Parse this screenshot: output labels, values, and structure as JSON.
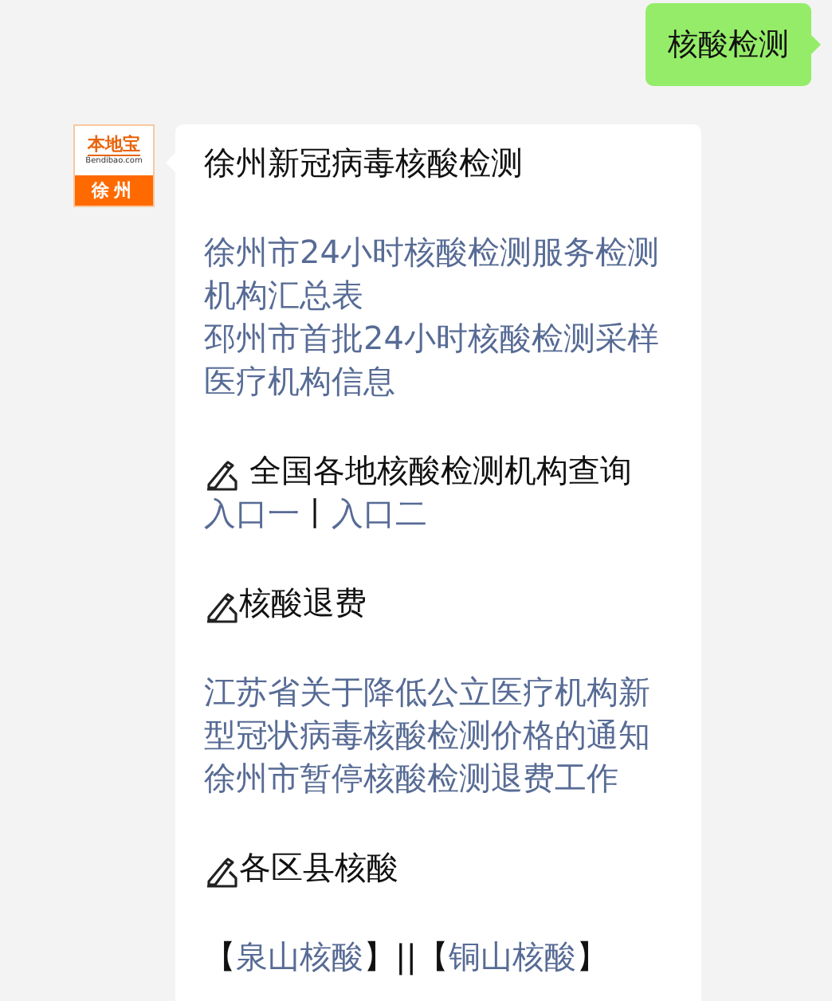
{
  "sent": {
    "text": "核酸检测"
  },
  "avatar": {
    "brand": "本地宝",
    "site": "Bendibao.com",
    "city": "徐州"
  },
  "message": {
    "blocks": [
      {
        "kind": "title",
        "text": "徐州新冠病毒核酸检测"
      },
      {
        "kind": "links",
        "items": [
          "徐州市24小时核酸检测服务检测机构汇总表",
          "邳州市首批24小时核酸检测采样医疗机构信息"
        ]
      },
      {
        "kind": "heading",
        "text": " 全国各地核酸检测机构查询",
        "lines": [
          [
            {
              "text": "入口一",
              "link": true
            },
            {
              "text": "丨",
              "link": false
            },
            {
              "text": "入口二",
              "link": true
            }
          ]
        ]
      },
      {
        "kind": "heading",
        "text": "核酸退费"
      },
      {
        "kind": "links",
        "items": [
          "江苏省关于降低公立医疗机构新型冠状病毒核酸检测价格的通知",
          "徐州市暂停核酸检测退费工作"
        ]
      },
      {
        "kind": "heading",
        "text": "各区县核酸"
      },
      {
        "kind": "line",
        "segments": [
          {
            "text": "【",
            "link": false
          },
          {
            "text": "泉山核酸",
            "link": true
          },
          {
            "text": "】",
            "link": false
          },
          {
            "text": "||",
            "link": false
          },
          {
            "text": "【",
            "link": false
          },
          {
            "text": "铜山核酸",
            "link": true
          },
          {
            "text": "】",
            "link": false
          }
        ]
      }
    ]
  }
}
